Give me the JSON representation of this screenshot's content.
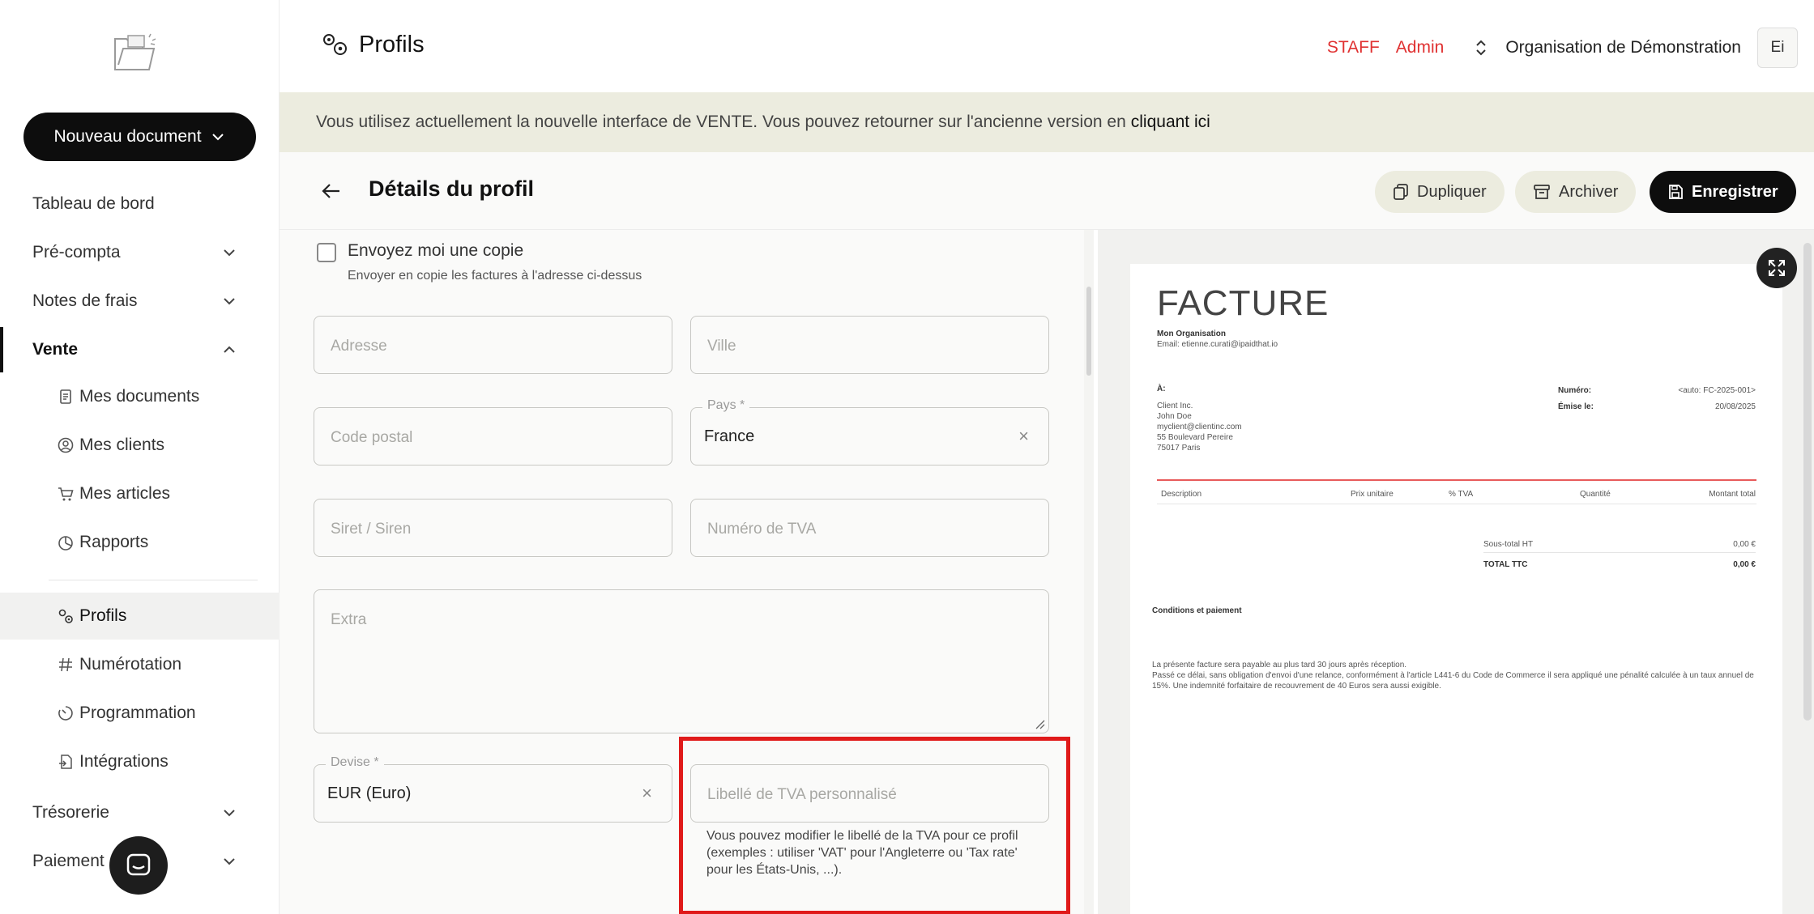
{
  "sidebar": {
    "new_document": "Nouveau document",
    "items": [
      {
        "label": "Tableau de bord"
      },
      {
        "label": "Pré-compta"
      },
      {
        "label": "Notes de frais"
      },
      {
        "label": "Vente"
      },
      {
        "label": "Trésorerie"
      },
      {
        "label": "Paiement"
      }
    ],
    "vente_sub": [
      {
        "label": "Mes documents",
        "icon": "document-icon"
      },
      {
        "label": "Mes clients",
        "icon": "user-circle-icon"
      },
      {
        "label": "Mes articles",
        "icon": "cart-icon"
      },
      {
        "label": "Rapports",
        "icon": "pie-chart-icon"
      }
    ],
    "settings_sub": [
      {
        "label": "Profils",
        "icon": "gears-icon"
      },
      {
        "label": "Numérotation",
        "icon": "hash-icon"
      },
      {
        "label": "Programmation",
        "icon": "timer-icon"
      },
      {
        "label": "Intégrations",
        "icon": "plug-doc-icon"
      }
    ]
  },
  "header": {
    "title": "Profils",
    "staff": "STAFF",
    "admin": "Admin",
    "organization": "Organisation de Démonstration",
    "avatar": "Ei"
  },
  "banner": {
    "text": "Vous utilisez actuellement la nouvelle interface de VENTE. Vous pouvez retourner sur l'ancienne version en",
    "link": "cliquant ici"
  },
  "detail": {
    "title": "Détails du profil",
    "duplicate": "Dupliquer",
    "archive": "Archiver",
    "save": "Enregistrer"
  },
  "form": {
    "copy_label": "Envoyez moi une copie",
    "copy_help": "Envoyer en copie les factures à l'adresse ci-dessus",
    "address_placeholder": "Adresse",
    "city_placeholder": "Ville",
    "postal_placeholder": "Code postal",
    "country_legend": "Pays *",
    "country_value": "France",
    "siret_placeholder": "Siret / Siren",
    "vat_number_placeholder": "Numéro de TVA",
    "extra_placeholder": "Extra",
    "currency_legend": "Devise *",
    "currency_value": "EUR (Euro)",
    "vat_label_placeholder": "Libellé de TVA personnalisé",
    "vat_label_help": "Vous pouvez modifier le libellé de la TVA pour ce profil (exemples : utiliser 'VAT' pour l'Angleterre ou 'Tax rate' pour les États-Unis, ...)."
  },
  "invoice": {
    "title": "FACTURE",
    "org_name": "Mon Organisation",
    "org_email": "Email: etienne.curati@ipaidthat.io",
    "to_label": "À:",
    "client_lines": [
      "Client Inc.",
      "John Doe",
      "myclient@clientinc.com",
      "55 Boulevard Pereire",
      "75017 Paris"
    ],
    "number_label": "Numéro:",
    "number_value": "<auto: FC-2025-001>",
    "issued_label": "Émise le:",
    "issued_value": "20/08/2025",
    "columns": [
      "Description",
      "Prix unitaire",
      "% TVA",
      "Quantité",
      "Montant total"
    ],
    "subtotal_label": "Sous-total HT",
    "subtotal_value": "0,00 €",
    "total_label": "TOTAL TTC",
    "total_value": "0,00 €",
    "conditions_title": "Conditions et paiement",
    "terms_1": "La présente facture sera payable au plus tard 30 jours après réception.",
    "terms_2": "Passé ce délai, sans obligation d'envoi d'une relance, conformément à l'article L441-6 du Code de Commerce il sera appliqué une pénalité calculée à un taux annuel de 15%. Une indemnité forfaitaire de recouvrement de 40 Euros sera aussi exigible."
  }
}
